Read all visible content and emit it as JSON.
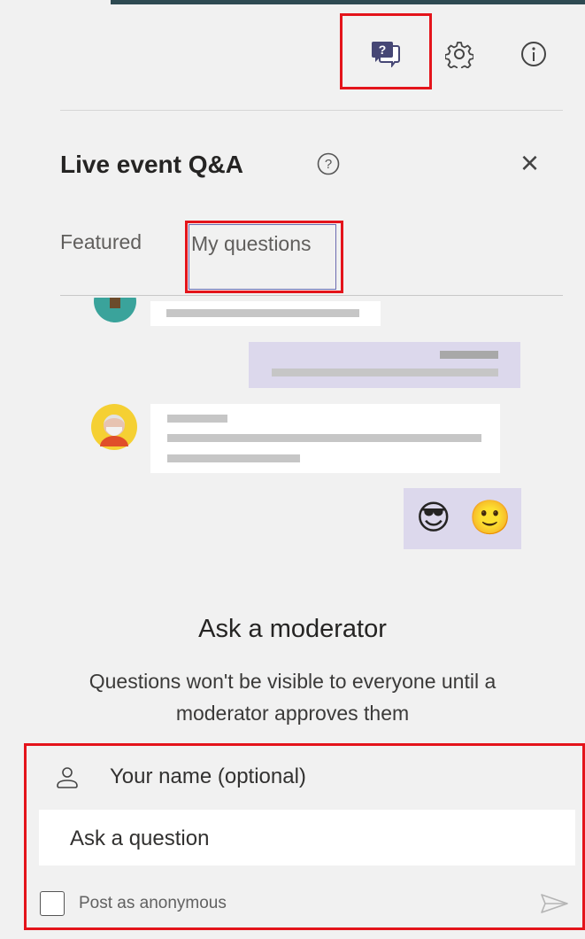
{
  "toolbar": {
    "icons": [
      "qa-chat-icon",
      "gear-icon",
      "info-icon"
    ]
  },
  "panel": {
    "title": "Live event Q&A",
    "close_symbol": "×"
  },
  "tabs": [
    {
      "label": "Featured"
    },
    {
      "label": "My questions"
    }
  ],
  "emojis": {
    "first": "😎",
    "second": "🙂"
  },
  "moderator": {
    "heading": "Ask a moderator",
    "line1": "Questions won't be visible to everyone until a",
    "line2": "moderator approves them"
  },
  "form": {
    "name_placeholder": "Your name (optional)",
    "question_placeholder": "Ask a question",
    "anonymous_label": "Post as anonymous"
  },
  "colors": {
    "highlight": "#e4141b",
    "accent": "#464775",
    "own_message": "#dcd8ec"
  }
}
